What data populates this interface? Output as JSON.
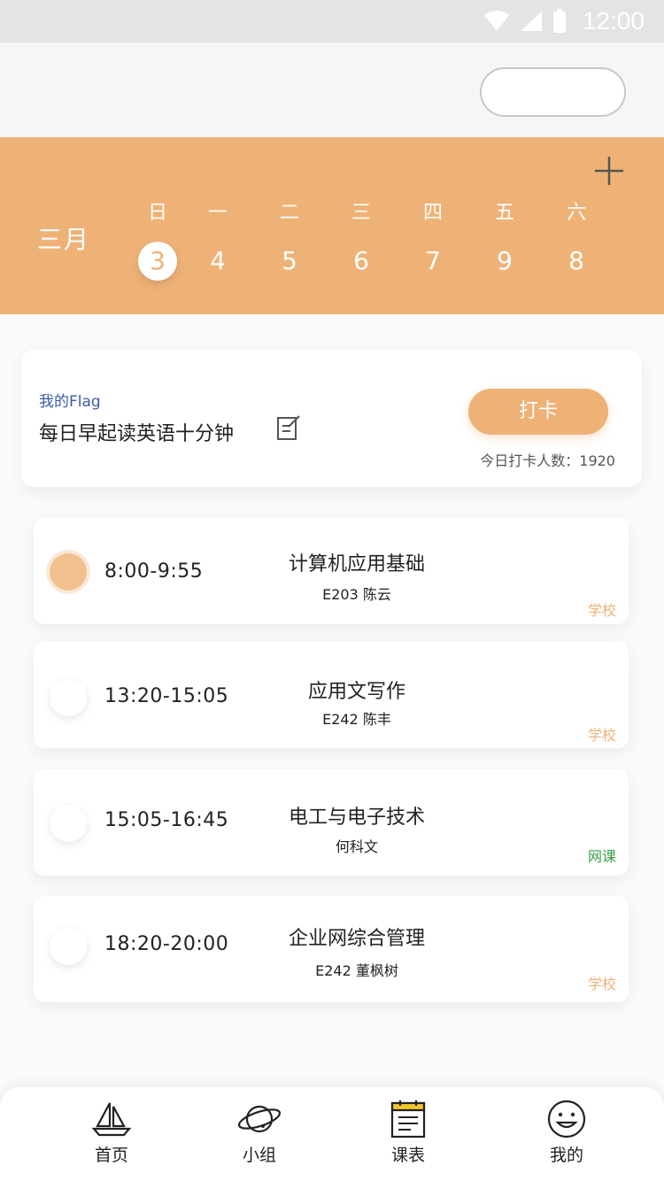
{
  "status": {
    "time": "12:00"
  },
  "calendar": {
    "month": "三月",
    "weekdays": [
      "日",
      "一",
      "二",
      "三",
      "四",
      "五",
      "六"
    ],
    "dates": [
      "3",
      "4",
      "5",
      "6",
      "7",
      "9",
      "8"
    ],
    "selected_index": 0,
    "accent": "#eeb277"
  },
  "flag": {
    "label": "我的Flag",
    "text": "每日早起读英语十分钟",
    "checkin_label": "打卡",
    "count_text": "今日打卡人数：1920"
  },
  "courses": [
    {
      "time": "8:00-9:55",
      "name": "计算机应用基础",
      "info": "E203 陈云",
      "tag": "学校",
      "tag_color": "#eeb277",
      "active": true
    },
    {
      "time": "13:20-15:05",
      "name": "应用文写作",
      "info": "E242 陈丰",
      "tag": "学校",
      "tag_color": "#eeb277",
      "active": false
    },
    {
      "time": "15:05-16:45",
      "name": "电工与电子技术",
      "info": "何科文",
      "tag": "网课",
      "tag_color": "#3aa04a",
      "active": false
    },
    {
      "time": "18:20-20:00",
      "name": "企业网综合管理",
      "info": "E242 董枫树",
      "tag": "学校",
      "tag_color": "#eeb277",
      "active": false
    }
  ],
  "nav": {
    "items": [
      {
        "label": "首页",
        "icon": "sailboat-icon"
      },
      {
        "label": "小组",
        "icon": "planet-icon"
      },
      {
        "label": "课表",
        "icon": "schedule-icon"
      },
      {
        "label": "我的",
        "icon": "smiley-icon"
      }
    ]
  }
}
